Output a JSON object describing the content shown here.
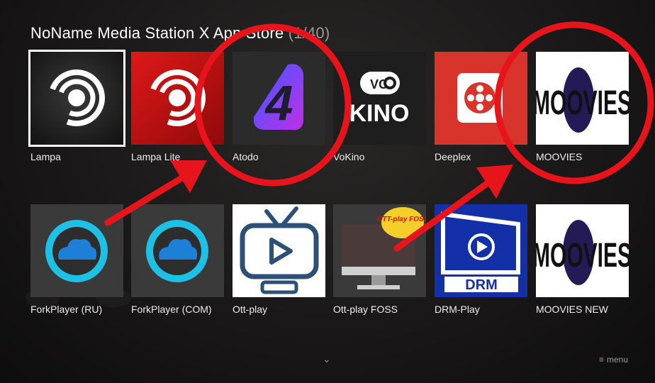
{
  "header": {
    "title": "NoName Media Station X App Store",
    "count": "(1/40)"
  },
  "apps": [
    {
      "label": "Lampa",
      "icon": "lampa-logo-icon"
    },
    {
      "label": "Lampa Lite",
      "icon": "lampa-lite-logo-icon"
    },
    {
      "label": "Atodo",
      "icon": "atodo-logo-icon",
      "glyph": "4"
    },
    {
      "label": "VoKino",
      "icon": "vokino-logo-icon",
      "logo_text": "KINO",
      "logo_prefix": "VO"
    },
    {
      "label": "Deeplex",
      "icon": "deeplex-logo-icon"
    },
    {
      "label": "MOOVIES",
      "icon": "moovies-logo-icon",
      "logo_text": "MOOVIES"
    },
    {
      "label": "ForkPlayer (RU)",
      "icon": "cloud-icon"
    },
    {
      "label": "ForkPlayer (COM)",
      "icon": "cloud-icon"
    },
    {
      "label": "Ott-play",
      "icon": "tv-play-icon"
    },
    {
      "label": "Ott-play FOSS",
      "icon": "monitor-icon",
      "badge": "OTT-play FOSS"
    },
    {
      "label": "DRM-Play",
      "icon": "drm-monitor-icon",
      "logo_text": "DRM"
    },
    {
      "label": "MOOVIES NEW",
      "icon": "moovies-logo-icon",
      "logo_text": "MOOVIES"
    }
  ],
  "footer": {
    "scroll_glyph": "⌄",
    "menu_label": "menu",
    "menu_glyph": "≡"
  },
  "colors": {
    "annotation_red": "#e8141b",
    "accent_red": "#cc1a1a",
    "atodo_purple": "#9b2fe6",
    "cloud_cyan": "#1ec0e6",
    "drm_blue": "#1330a8"
  }
}
